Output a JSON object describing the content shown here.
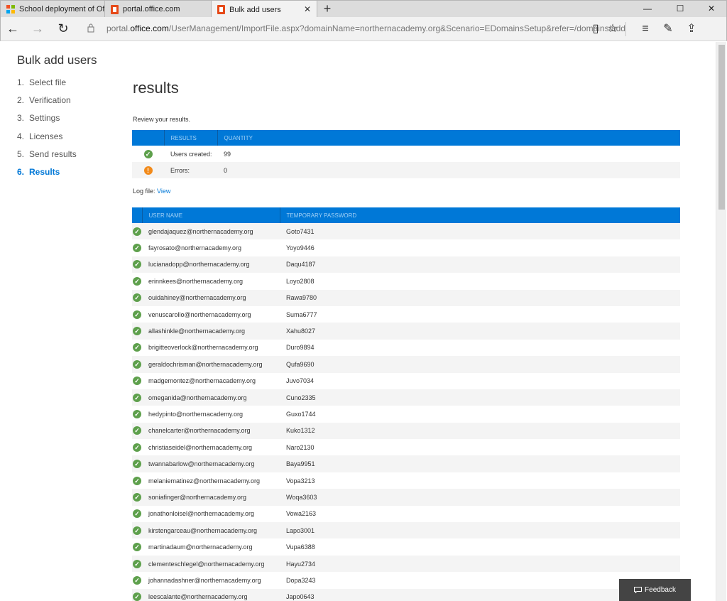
{
  "browser": {
    "tabs": [
      {
        "title": "School deployment of Offic",
        "icon": "microsoft-logo"
      },
      {
        "title": "portal.office.com",
        "icon": "office-logo"
      },
      {
        "title": "Bulk add users",
        "icon": "office-logo",
        "close": "✕"
      }
    ],
    "new_tab": "+",
    "window_controls": {
      "minimize": "—",
      "maximize": "☐",
      "close": "✕"
    },
    "nav": {
      "back": "←",
      "forward": "→",
      "refresh": "↻"
    },
    "url_prefix": "portal.",
    "url_host": "office.com",
    "url_path": "/UserManagement/ImportFile.aspx?domainName=northernacademy.org&Scenario=EDomainsSetup&refer=/domains/add",
    "toolbar": {
      "reading_view": "▯",
      "favorites": "☆",
      "hub": "≡",
      "notes": "✎",
      "share": "⇪"
    }
  },
  "sidebar": {
    "title": "Bulk add users",
    "steps": [
      {
        "num": "1.",
        "label": "Select file"
      },
      {
        "num": "2.",
        "label": "Verification"
      },
      {
        "num": "3.",
        "label": "Settings"
      },
      {
        "num": "4.",
        "label": "Licenses"
      },
      {
        "num": "5.",
        "label": "Send results"
      },
      {
        "num": "6.",
        "label": "Results"
      }
    ],
    "current_step": 6
  },
  "main": {
    "heading": "results",
    "review_text": "Review your results.",
    "summary": {
      "headers": [
        "RESULTS",
        "QUANTITY"
      ],
      "rows": [
        {
          "status": "ok",
          "label": "Users created:",
          "value": "99"
        },
        {
          "status": "warning",
          "label": "Errors:",
          "value": "0"
        }
      ]
    },
    "log_file_label": "Log file:",
    "log_file_link": "View",
    "users_table": {
      "headers": [
        "USER NAME",
        "TEMPORARY PASSWORD"
      ],
      "rows": [
        {
          "user": "glendajaquez@northernacademy.org",
          "password": "Goto7431"
        },
        {
          "user": "fayrosato@northernacademy.org",
          "password": "Yoyo9446"
        },
        {
          "user": "lucianadopp@northernacademy.org",
          "password": "Daqu4187"
        },
        {
          "user": "erinnkees@northernacademy.org",
          "password": "Loyo2808"
        },
        {
          "user": "ouidahiney@northernacademy.org",
          "password": "Rawa9780"
        },
        {
          "user": "venuscarollo@northernacademy.org",
          "password": "Suma6777"
        },
        {
          "user": "allashinkle@northernacademy.org",
          "password": "Xahu8027"
        },
        {
          "user": "brigitteoverlock@northernacademy.org",
          "password": "Duro9894"
        },
        {
          "user": "geraldochrisman@northernacademy.org",
          "password": "Qufa9690"
        },
        {
          "user": "madgemontez@northernacademy.org",
          "password": "Juvo7034"
        },
        {
          "user": "omeganida@northernacademy.org",
          "password": "Cuno2335"
        },
        {
          "user": "hedypinto@northernacademy.org",
          "password": "Guxo1744"
        },
        {
          "user": "chanelcarter@northernacademy.org",
          "password": "Kuko1312"
        },
        {
          "user": "christiaseidel@northernacademy.org",
          "password": "Naro2130"
        },
        {
          "user": "twannabarlow@northernacademy.org",
          "password": "Baya9951"
        },
        {
          "user": "melaniematinez@northernacademy.org",
          "password": "Vopa3213"
        },
        {
          "user": "soniafinger@northernacademy.org",
          "password": "Woqa3603"
        },
        {
          "user": "jonathonloisel@northernacademy.org",
          "password": "Vowa2163"
        },
        {
          "user": "kirstengarceau@northernacademy.org",
          "password": "Lapo3001"
        },
        {
          "user": "martinadaum@northernacademy.org",
          "password": "Vupa6388"
        },
        {
          "user": "clementeschlegel@northernacademy.org",
          "password": "Hayu2734"
        },
        {
          "user": "johannadashner@northernacademy.org",
          "password": "Dopa3243"
        },
        {
          "user": "leescalante@northernacademy.org",
          "password": "Japo0643"
        }
      ]
    }
  },
  "feedback_button": "Feedback",
  "colors": {
    "accent": "#0078d7",
    "success": "#5ea04c",
    "warning": "#f28a1a"
  }
}
